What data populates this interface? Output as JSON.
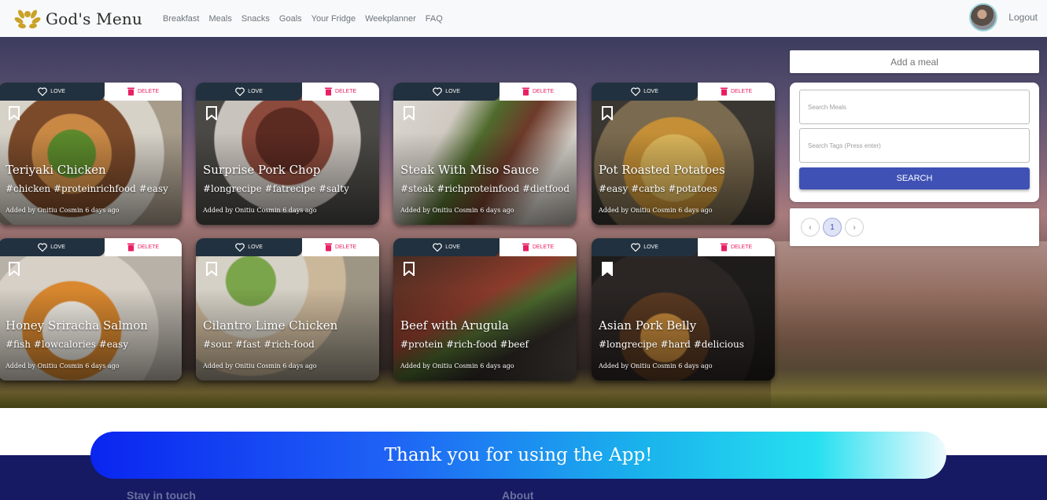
{
  "navbar": {
    "brand": "God's Menu",
    "links": [
      "Breakfast",
      "Meals",
      "Snacks",
      "Goals",
      "Your Fridge",
      "Weekplanner",
      "FAQ"
    ],
    "logout": "Logout"
  },
  "card_actions": {
    "love": "LOVE",
    "delete": "DELETE"
  },
  "meals": [
    {
      "title": "Teriyaki Chicken",
      "tags": "#chicken #proteinrichfood #easy",
      "meta": "Added by Onitiu Cosmin 6 days ago"
    },
    {
      "title": "Surprise Pork Chop",
      "tags": "#longrecipe #fatrecipe #salty",
      "meta": "Added by Onitiu Cosmin 6 days ago"
    },
    {
      "title": "Steak With Miso Sauce",
      "tags": "#steak #richproteinfood #dietfood",
      "meta": "Added by Onitiu Cosmin 6 days ago"
    },
    {
      "title": "Pot Roasted Potatoes",
      "tags": "#easy #carbs #potatoes",
      "meta": "Added by Onitiu Cosmin 6 days ago"
    },
    {
      "title": "Honey Sriracha Salmon",
      "tags": "#fish #lowcalories #easy",
      "meta": "Added by Onitiu Cosmin 6 days ago"
    },
    {
      "title": "Cilantro Lime Chicken",
      "tags": "#sour #fast #rich-food",
      "meta": "Added by Onitiu Cosmin 6 days ago"
    },
    {
      "title": "Beef with Arugula",
      "tags": "#protein #rich-food #beef",
      "meta": "Added by Onitiu Cosmin 6 days ago"
    },
    {
      "title": "Asian Pork Belly",
      "tags": "#longrecipe #hard #delicious",
      "meta": "Added by Onitiu Cosmin 6 days ago"
    }
  ],
  "sidebar": {
    "add_meal": "Add a meal",
    "search_meals_placeholder": "Search Meals",
    "search_tags_placeholder": "Search Tags (Press enter)",
    "search_button": "SEARCH",
    "pagination": {
      "prev": "‹",
      "current": "1",
      "next": "›"
    }
  },
  "footer": {
    "thanks": "Thank you for using the App!",
    "col_left": "Stay in touch",
    "col_right": "About"
  },
  "colors": {
    "love_bg": "#22313f",
    "delete_text": "#e91e63",
    "search_button": "#3f51b5",
    "footer_bg": "#151a63"
  }
}
